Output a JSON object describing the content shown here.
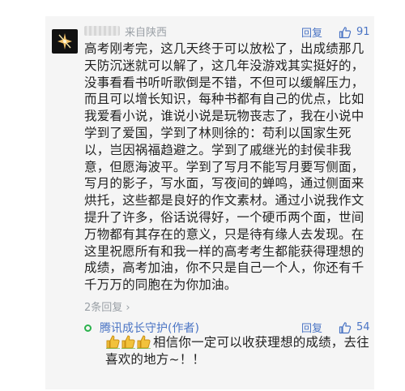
{
  "comment": {
    "location": "来自陕西",
    "reply_label": "回复",
    "likes": "91",
    "text": "高考刚考完，这几天终于可以放松了，出成绩那几天防沉迷就可以解了，这几年没游戏其实挺好的，没事看看书听听歌倒是不错，不但可以缓解压力，而且可以增长知识，每种书都有自己的优点，比如我爱看小说，谁说小说是玩物丧志了，我在小说中学到了爱国，学到了林则徐的：苟利以国家生死以，岂因祸福趋避之。学到了戚继光的封侯非我意，但愿海波平。学到了写月不能写月要写侧面，写月的影子，写水面，写夜间的蝉鸣，通过侧面来烘托，这些都是良好的作文素材。通过小说我作文提升了许多，俗话说得好，一个硬币两个面，世间万物都有其存在的意义，只是待有缘人去发现。在这里祝愿所有和我一样的高考考生都能获得理想的成绩，高考加油，你不只是自己一个人，你还有千千万万的同胞在为你加油。",
    "more_replies": "2条回复 ›"
  },
  "sub_reply": {
    "author": "腾讯成长守护(作者)",
    "reply_label": "回复",
    "likes": "54",
    "text": "相信你一定可以收获理想的成绩，去往喜欢的地方~！！"
  },
  "icons": {
    "avatar": "sparkle-avatar-icon",
    "like": "thumb-up-icon",
    "author_badge": "green-circle-icon",
    "emoji": "thumbs-up-emoji-icon"
  },
  "colors": {
    "link_blue": "#4a74c4",
    "meta_gray": "#9aa0a6",
    "card_bg": "#f5f5f5",
    "badge_green": "#2bb24c",
    "emoji_yellow": "#f2c23b"
  }
}
